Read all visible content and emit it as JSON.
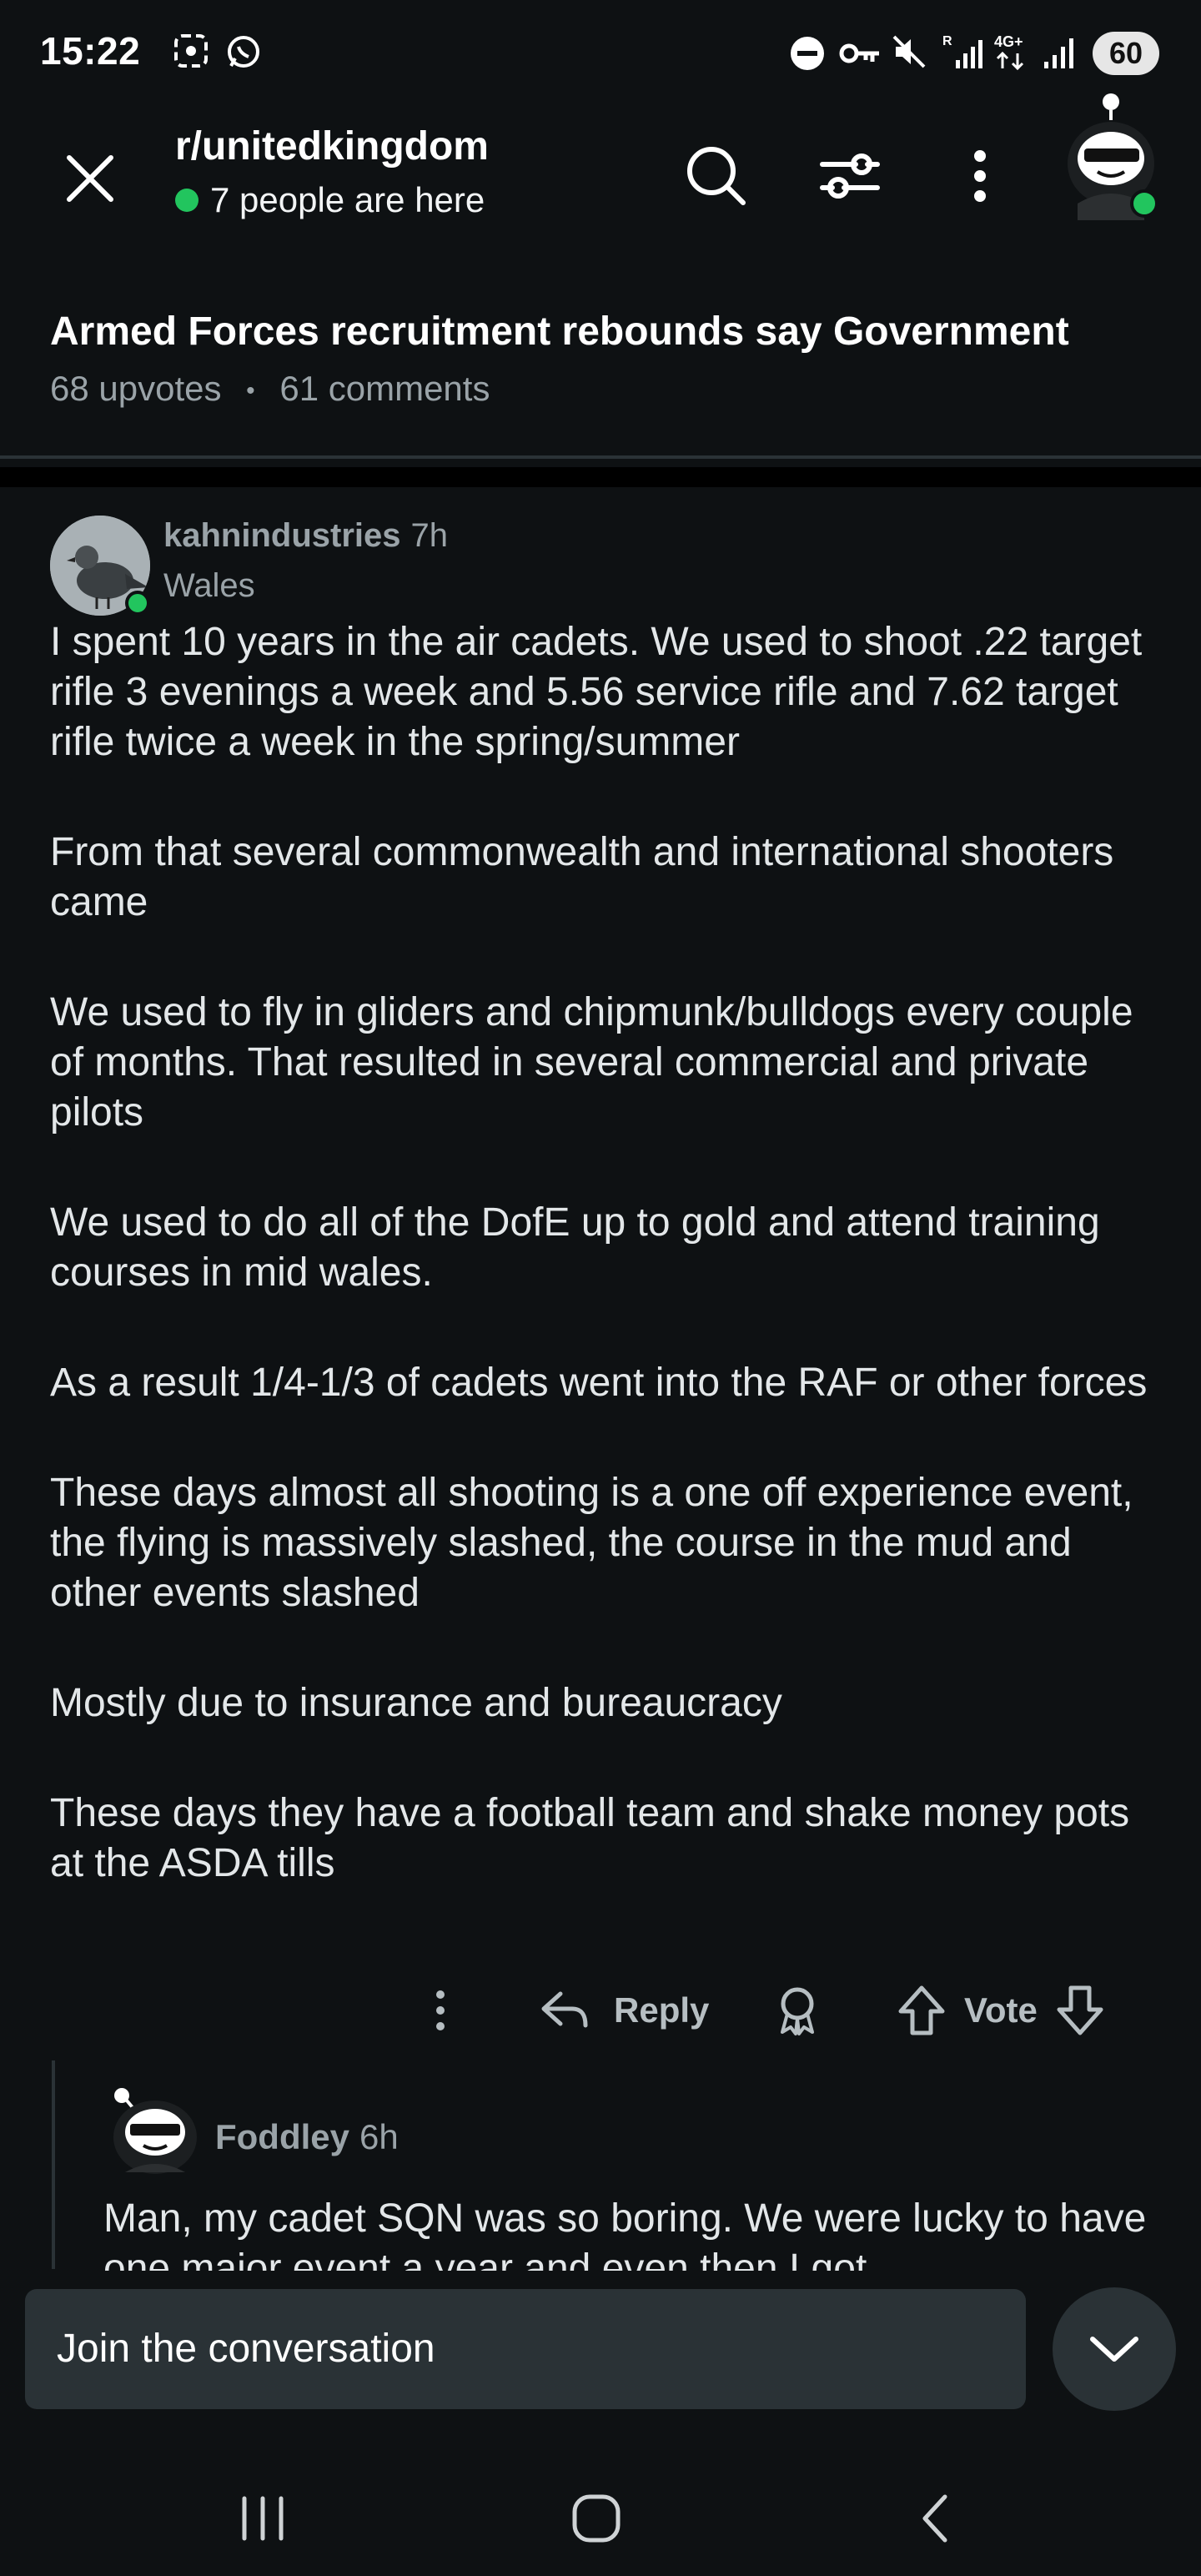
{
  "status_bar": {
    "time": "15:22",
    "battery": "60"
  },
  "header": {
    "subreddit": "r/unitedkingdom",
    "online_text": "7 people are here"
  },
  "post": {
    "title": "Armed Forces recruitment rebounds say Government",
    "upvotes": "68 upvotes",
    "separator": "•",
    "comments": "61 comments"
  },
  "comment": {
    "author": "kahnindustries",
    "age": "7h",
    "flair": "Wales",
    "paragraphs": [
      "I spent 10 years in the air cadets. We used to shoot .22 target rifle 3 evenings a week and 5.56 service rifle and 7.62 target rifle twice a week in the spring/summer",
      "From that several commonwealth and international shooters came",
      "We used to fly in gliders and chipmunk/bulldogs every couple of months. That resulted in several commercial and private pilots",
      "We used to do all of the DofE up to gold and attend training courses in mid wales.",
      "As a result 1/4-1/3 of cadets went into the RAF or other forces",
      "These days almost all shooting is a one off experience event, the flying is massively slashed, the course in the mud and other events slashed",
      "Mostly due to insurance and bureaucracy",
      "These days they have a football team and shake money pots at the ASDA tills"
    ],
    "reply_label": "Reply",
    "vote_label": "Vote"
  },
  "reply": {
    "author": "Foddley",
    "age": "6h",
    "text": "Man, my cadet SQN was so boring. We were lucky to have one major event a year and even then I got"
  },
  "composer": {
    "placeholder": "Join the conversation"
  },
  "icons": {
    "close": "close-icon",
    "search": "search-icon",
    "filter": "filter-icon",
    "more": "more-vertical-icon",
    "award": "award-icon",
    "upvote": "upvote-arrow-icon",
    "downvote": "downvote-arrow-icon",
    "reply": "reply-arrow-icon",
    "collapse": "chevron-down-icon"
  },
  "colors": {
    "background": "#0e1113",
    "online_green": "#22c55e",
    "muted_text": "#9aa3a8"
  }
}
